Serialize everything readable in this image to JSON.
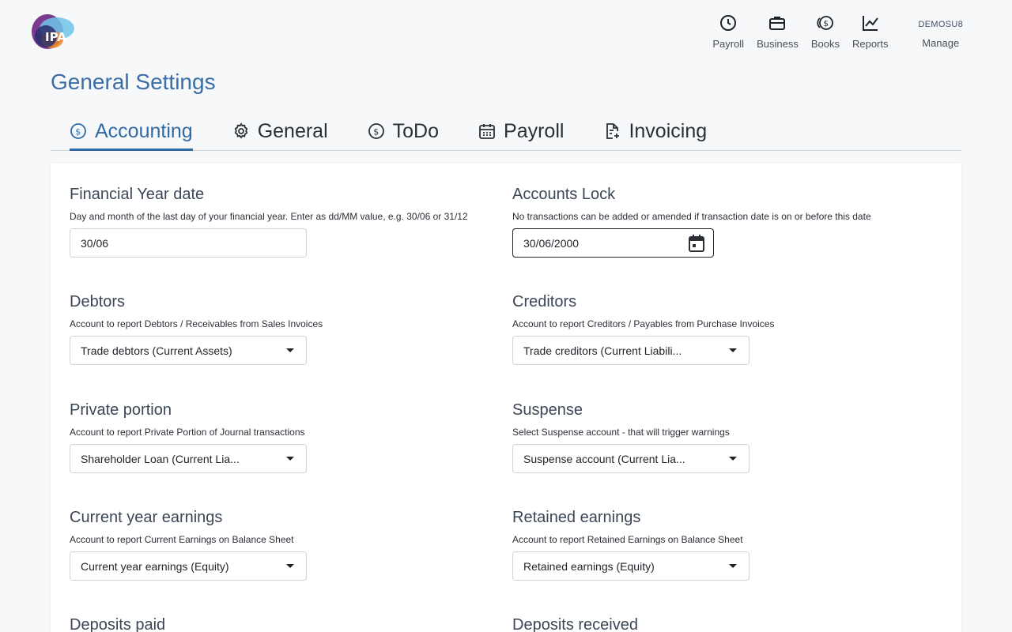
{
  "app": {
    "logo_text": "IPA"
  },
  "topnav": {
    "items": [
      {
        "label": "Payroll",
        "icon": "clock-icon"
      },
      {
        "label": "Business",
        "icon": "briefcase-icon"
      },
      {
        "label": "Books",
        "icon": "coins-icon"
      },
      {
        "label": "Reports",
        "icon": "chart-line-icon"
      }
    ],
    "user": {
      "name": "DEMOSU8",
      "label": "Manage"
    }
  },
  "page": {
    "title": "General Settings"
  },
  "tabs": [
    {
      "label": "Accounting",
      "icon": "dollar-circle-icon",
      "active": true
    },
    {
      "label": "General",
      "icon": "gear-icon",
      "active": false
    },
    {
      "label": "ToDo",
      "icon": "dollar-circle-icon",
      "active": false
    },
    {
      "label": "Payroll",
      "icon": "calendar-icon",
      "active": false
    },
    {
      "label": "Invoicing",
      "icon": "document-add-icon",
      "active": false
    }
  ],
  "fields": {
    "financial_year": {
      "title": "Financial Year date",
      "help": "Day and month of the last day of your financial year. Enter as dd/MM value, e.g. 30/06 or 31/12",
      "value": "30/06"
    },
    "accounts_lock": {
      "title": "Accounts Lock",
      "help": "No transactions can be added or amended if transaction date is on or before this date",
      "value": "30/06/2000"
    },
    "debtors": {
      "title": "Debtors",
      "help": "Account to report Debtors / Receivables from Sales Invoices",
      "value": "Trade debtors (Current Assets)"
    },
    "creditors": {
      "title": "Creditors",
      "help": "Account to report Creditors / Payables from Purchase Invoices",
      "value": "Trade creditors (Current Liabili..."
    },
    "private_portion": {
      "title": "Private portion",
      "help": "Account to report Private Portion of Journal transactions",
      "value": "Shareholder Loan (Current Lia..."
    },
    "suspense": {
      "title": "Suspense",
      "help": "Select Suspense account - that will trigger warnings",
      "value": "Suspense account (Current Lia..."
    },
    "current_year_earnings": {
      "title": "Current year earnings",
      "help": "Account to report Current Earnings on Balance Sheet",
      "value": "Current year earnings (Equity)"
    },
    "retained_earnings": {
      "title": "Retained earnings",
      "help": "Account to report Retained Earnings on Balance Sheet",
      "value": "Retained earnings (Equity)"
    },
    "deposits_paid": {
      "title": "Deposits paid"
    },
    "deposits_received": {
      "title": "Deposits received"
    }
  },
  "colors": {
    "accent": "#2f6aa6",
    "title": "#3a6ea5"
  }
}
